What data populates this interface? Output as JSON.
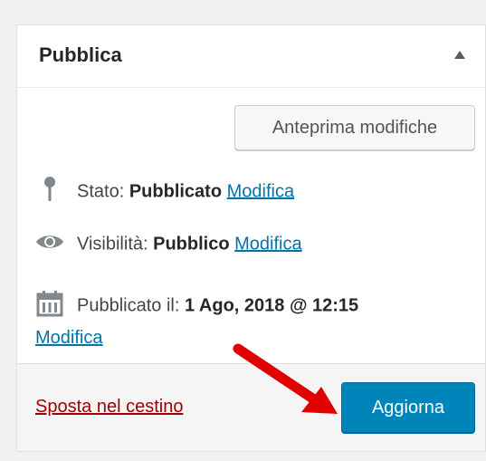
{
  "box": {
    "title": "Pubblica"
  },
  "preview_button": "Anteprima modifiche",
  "status": {
    "label": "Stato:",
    "value": "Pubblicato",
    "edit": "Modifica"
  },
  "visibility": {
    "label": "Visibilità:",
    "value": "Pubblico",
    "edit": "Modifica"
  },
  "published": {
    "label": "Pubblicato il:",
    "value": "1 Ago, 2018 @ 12:15",
    "edit": "Modifica"
  },
  "footer": {
    "trash": "Sposta nel cestino",
    "update": "Aggiorna"
  },
  "colors": {
    "primary": "#0085ba",
    "link": "#0073aa",
    "trash": "#a00000",
    "annotation_arrow": "#e00000"
  },
  "icons": [
    "pin-icon",
    "eye-icon",
    "calendar-icon"
  ]
}
